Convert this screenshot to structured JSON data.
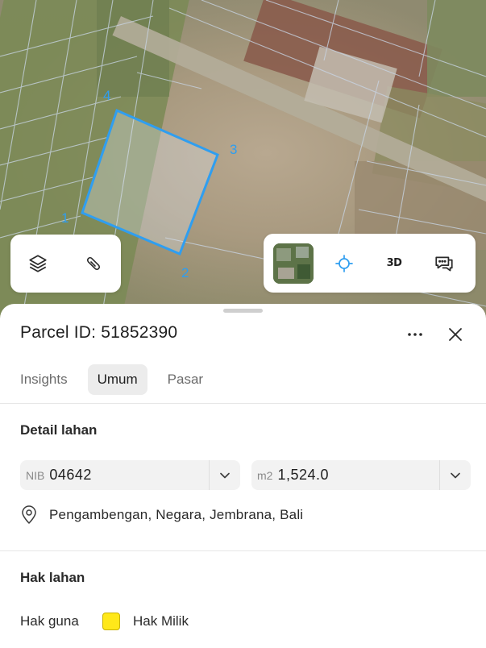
{
  "map": {
    "parcel_vertices": [
      "1",
      "2",
      "3",
      "4"
    ],
    "parcel_outline_color": "#2f9ef0",
    "tools_left": [
      {
        "icon": "layers-icon"
      },
      {
        "icon": "ruler-measure-icon"
      }
    ],
    "tools_right": [
      {
        "icon": "satellite-thumbnail"
      },
      {
        "icon": "locate-crosshair-icon"
      },
      {
        "label": "3D"
      },
      {
        "icon": "chat-bubble-icon"
      }
    ]
  },
  "sheet": {
    "title": "Parcel ID: 51852390",
    "tabs": [
      {
        "label": "Insights",
        "active": false
      },
      {
        "label": "Umum",
        "active": true
      },
      {
        "label": "Pasar",
        "active": false
      }
    ],
    "detail": {
      "heading": "Detail lahan",
      "nib_prefix": "NIB",
      "nib_value": "04642",
      "area_prefix": "m2",
      "area_value": "1,524.0",
      "address": "Pengambengan, Negara, Jembrana, Bali"
    },
    "rights": {
      "heading": "Hak lahan",
      "label": "Hak guna",
      "swatch_color": "#ffe81a",
      "value": "Hak Milik"
    }
  }
}
